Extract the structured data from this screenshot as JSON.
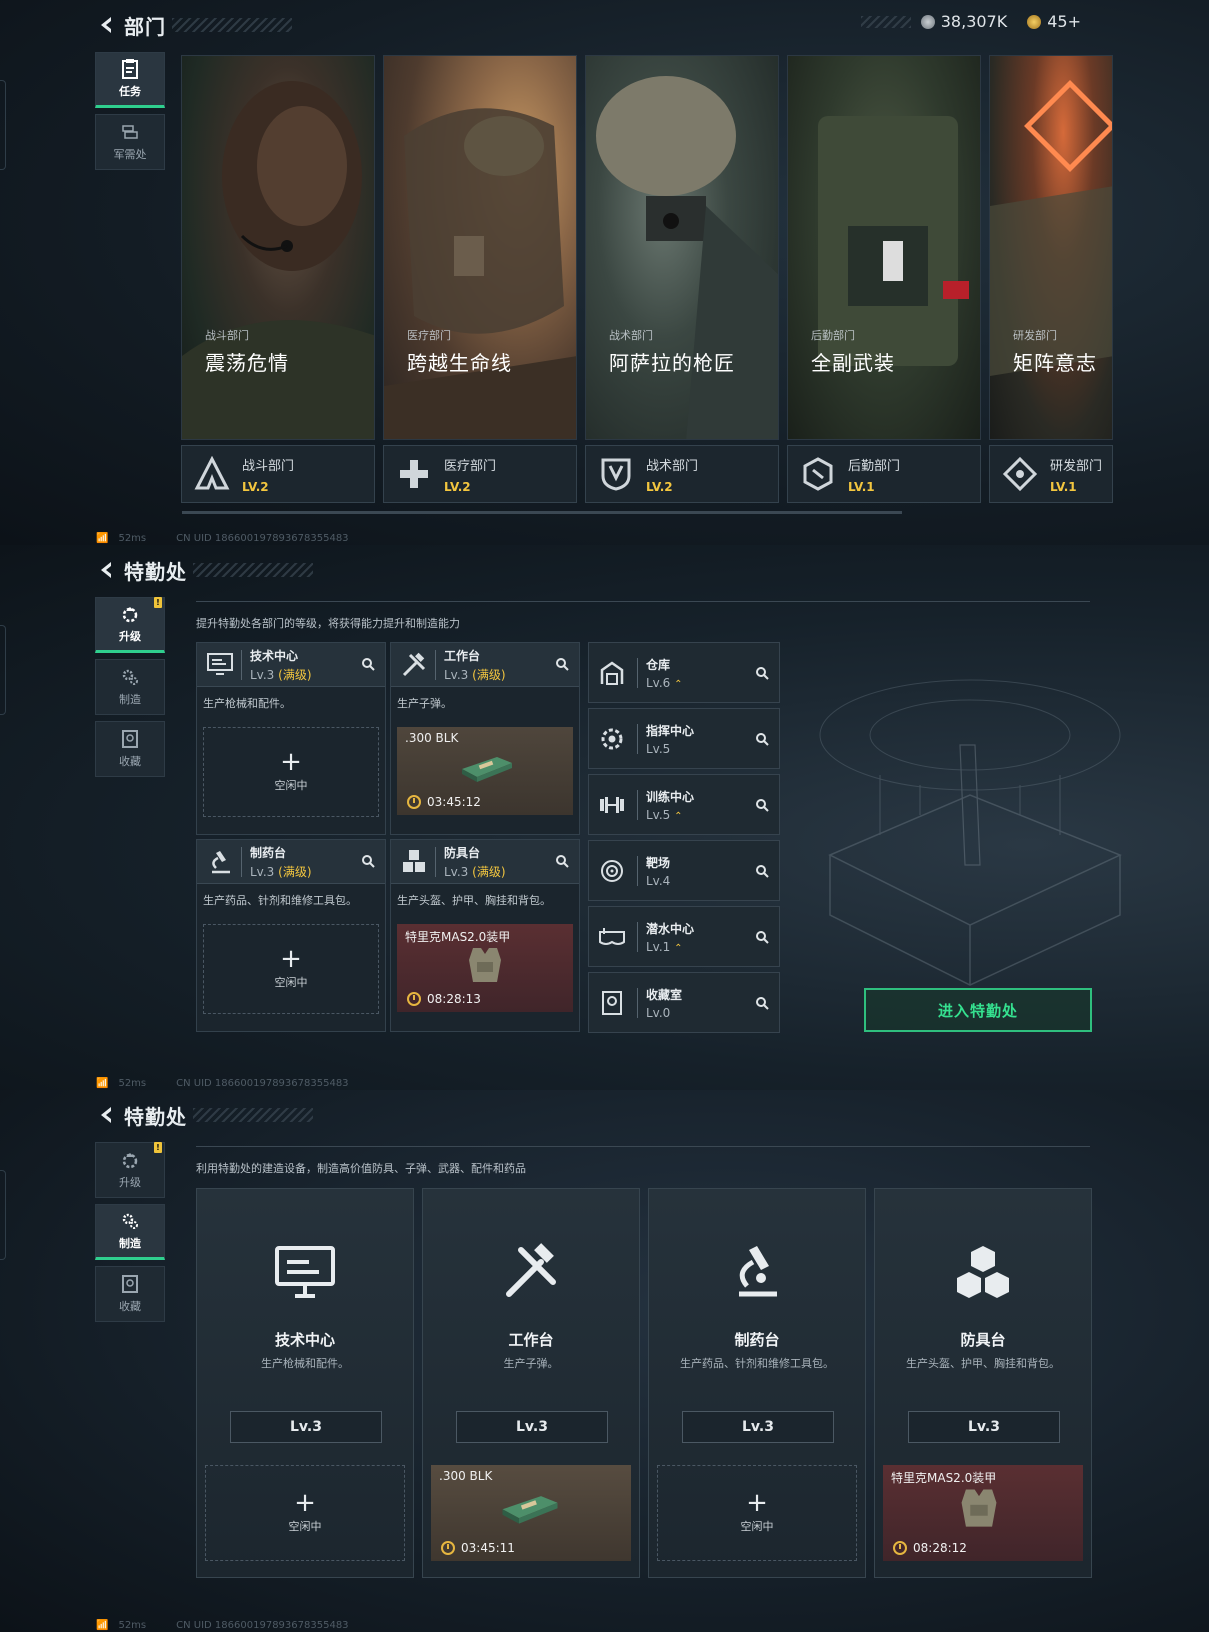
{
  "s1": {
    "title": "部门",
    "currency1": "38,307K",
    "currency2": "45+",
    "tabs": [
      {
        "label": "任务"
      },
      {
        "label": "军需处"
      }
    ],
    "depts": [
      {
        "sub": "战斗部门",
        "name": "震荡危情",
        "bar_name": "战斗部门",
        "level": "LV.2"
      },
      {
        "sub": "医疗部门",
        "name": "跨越生命线",
        "bar_name": "医疗部门",
        "level": "LV.2"
      },
      {
        "sub": "战术部门",
        "name": "阿萨拉的枪匠",
        "bar_name": "战术部门",
        "level": "LV.2"
      },
      {
        "sub": "后勤部门",
        "name": "全副武装",
        "bar_name": "后勤部门",
        "level": "LV.1"
      },
      {
        "sub": "研发部门",
        "name": "矩阵意志",
        "bar_name": "研发部门",
        "level": "LV.1"
      }
    ],
    "footer_ping": "52ms",
    "footer_uid": "CN UID 1866001978936783554​83"
  },
  "s2": {
    "title": "特勤处",
    "tabs": [
      {
        "label": "升级"
      },
      {
        "label": "制造"
      },
      {
        "label": "收藏"
      }
    ],
    "desc": "提升特勤处各部门的等级，将获得能力提升和制造能力",
    "facilities": [
      {
        "name": "技术中心",
        "level": "Lv.3",
        "max": "(满级)",
        "desc": "生产枪械和配件。",
        "slot": "空闲中"
      },
      {
        "name": "工作台",
        "level": "Lv.3",
        "max": "(满级)",
        "desc": "生产子弹。",
        "product": ".300 BLK",
        "time": "03:45:12"
      },
      {
        "name": "制药台",
        "level": "Lv.3",
        "max": "(满级)",
        "desc": "生产药品、针剂和维修工具包。",
        "slot": "空闲中"
      },
      {
        "name": "防具台",
        "level": "Lv.3",
        "max": "(满级)",
        "desc": "生产头盔、护甲、胸挂和背包。",
        "product": "特里克MAS2.0装甲",
        "time": "08:28:13"
      }
    ],
    "buildings": [
      {
        "name": "仓库",
        "level": "Lv.6",
        "up": true
      },
      {
        "name": "指挥中心",
        "level": "Lv.5",
        "up": false
      },
      {
        "name": "训练中心",
        "level": "Lv.5",
        "up": true
      },
      {
        "name": "靶场",
        "level": "Lv.4",
        "up": false
      },
      {
        "name": "潜水中心",
        "level": "Lv.1",
        "up": true
      },
      {
        "name": "收藏室",
        "level": "Lv.0",
        "up": false
      }
    ],
    "enter": "进入特勤处",
    "footer_ping": "52ms",
    "footer_uid": "CN UID 1866001978936783554​83"
  },
  "s3": {
    "title": "特勤处",
    "tabs": [
      {
        "label": "升级"
      },
      {
        "label": "制造"
      },
      {
        "label": "收藏"
      }
    ],
    "desc": "利用特勤处的建造设备，制造高价值防具、子弹、武器、配件和药品",
    "cards": [
      {
        "name": "技术中心",
        "desc": "生产枪械和配件。",
        "level": "Lv.3",
        "slot": "空闲中"
      },
      {
        "name": "工作台",
        "desc": "生产子弹。",
        "level": "Lv.3",
        "product": ".300 BLK",
        "time": "03:45:11"
      },
      {
        "name": "制药台",
        "desc": "生产药品、针剂和维修工具包。",
        "level": "Lv.3",
        "slot": "空闲中"
      },
      {
        "name": "防具台",
        "desc": "生产头盔、护甲、胸挂和背包。",
        "level": "Lv.3",
        "product": "特里克MAS2.0装甲",
        "time": "08:28:12"
      }
    ],
    "footer_ping": "52ms",
    "footer_uid": "CN UID 1866001978936783554​83"
  },
  "colors": {
    "accent_green": "#2fcf8e",
    "level_yellow": "#f3c63f",
    "bg": "#0e151c"
  }
}
